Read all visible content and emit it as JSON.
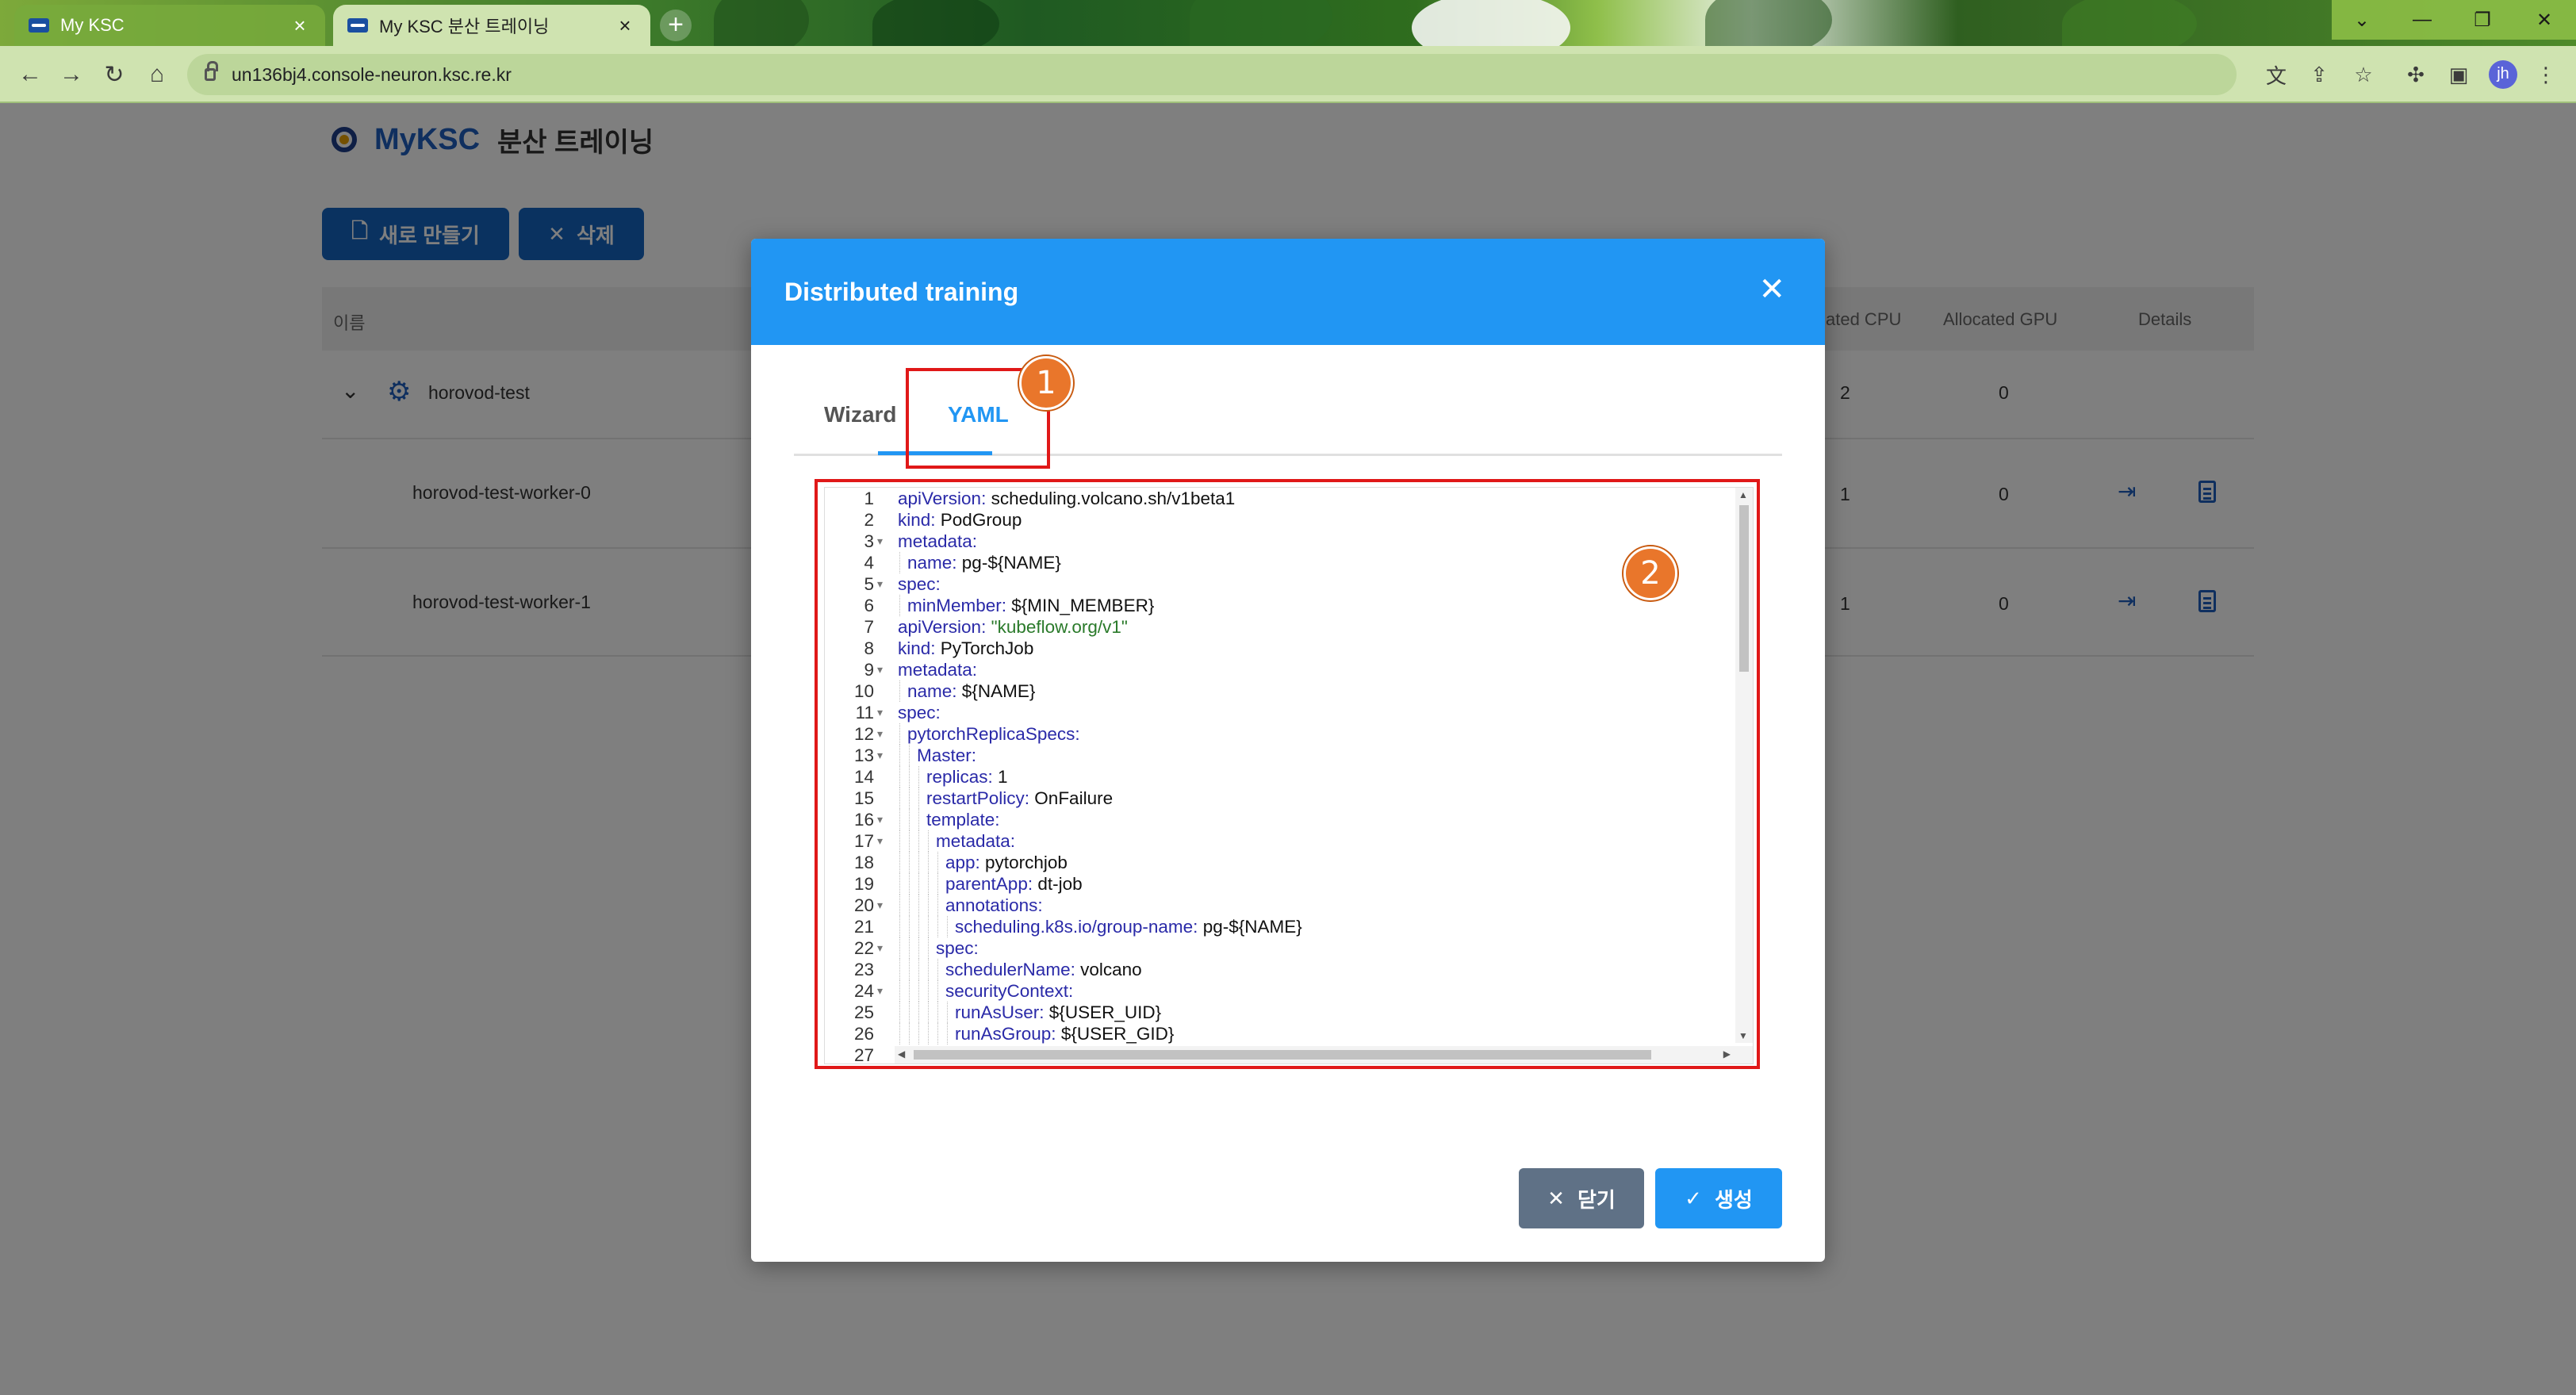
{
  "browser": {
    "tabs": [
      {
        "label": "My KSC",
        "active": false
      },
      {
        "label": "My KSC 분산 트레이닝",
        "active": true
      }
    ],
    "url": "un136bj4.console-neuron.ksc.re.kr",
    "profile_initials": "jh"
  },
  "page": {
    "brand": "MyKSC",
    "title": "분산 트레이닝",
    "new_button": "새로 만들기",
    "delete_button": "삭제",
    "table": {
      "columns": [
        "이름",
        "ated CPU",
        "Allocated GPU",
        "Details"
      ],
      "rows": [
        {
          "name": "horovod-test",
          "cpu": "2",
          "gpu": "0",
          "expanded": true
        },
        {
          "name": "horovod-test-worker-0",
          "cpu": "1",
          "gpu": "0"
        },
        {
          "name": "horovod-test-worker-1",
          "cpu": "1",
          "gpu": "0"
        }
      ]
    }
  },
  "modal": {
    "title": "Distributed training",
    "tabs": {
      "wizard": "Wizard",
      "yaml": "YAML"
    },
    "active_tab": "YAML",
    "badges": {
      "one": "1",
      "two": "2"
    },
    "close_button": "닫기",
    "create_button": "생성",
    "yaml_lines": [
      {
        "n": "1",
        "fold": false,
        "indent": 0,
        "key": "apiVersion",
        "val": " scheduling.volcano.sh/v1beta1",
        "str": false
      },
      {
        "n": "2",
        "fold": false,
        "indent": 0,
        "key": "kind",
        "val": " PodGroup",
        "str": false
      },
      {
        "n": "3",
        "fold": true,
        "indent": 0,
        "key": "metadata",
        "val": "",
        "str": false
      },
      {
        "n": "4",
        "fold": false,
        "indent": 1,
        "key": "name",
        "val": " pg-${NAME}",
        "str": false
      },
      {
        "n": "5",
        "fold": true,
        "indent": 0,
        "key": "spec",
        "val": "",
        "str": false
      },
      {
        "n": "6",
        "fold": false,
        "indent": 1,
        "key": "minMember",
        "val": " ${MIN_MEMBER}",
        "str": false
      },
      {
        "n": "7",
        "fold": false,
        "indent": 0,
        "key": "apiVersion",
        "val": " \"kubeflow.org/v1\"",
        "str": true
      },
      {
        "n": "8",
        "fold": false,
        "indent": 0,
        "key": "kind",
        "val": " PyTorchJob",
        "str": false
      },
      {
        "n": "9",
        "fold": true,
        "indent": 0,
        "key": "metadata",
        "val": "",
        "str": false
      },
      {
        "n": "10",
        "fold": false,
        "indent": 1,
        "key": "name",
        "val": " ${NAME}",
        "str": false
      },
      {
        "n": "11",
        "fold": true,
        "indent": 0,
        "key": "spec",
        "val": "",
        "str": false
      },
      {
        "n": "12",
        "fold": true,
        "indent": 1,
        "key": "pytorchReplicaSpecs",
        "val": "",
        "str": false
      },
      {
        "n": "13",
        "fold": true,
        "indent": 2,
        "key": "Master",
        "val": "",
        "str": false
      },
      {
        "n": "14",
        "fold": false,
        "indent": 3,
        "key": "replicas",
        "val": " 1",
        "str": false
      },
      {
        "n": "15",
        "fold": false,
        "indent": 3,
        "key": "restartPolicy",
        "val": " OnFailure",
        "str": false
      },
      {
        "n": "16",
        "fold": true,
        "indent": 3,
        "key": "template",
        "val": "",
        "str": false
      },
      {
        "n": "17",
        "fold": true,
        "indent": 4,
        "key": "metadata",
        "val": "",
        "str": false
      },
      {
        "n": "18",
        "fold": false,
        "indent": 5,
        "key": "app",
        "val": " pytorchjob",
        "str": false
      },
      {
        "n": "19",
        "fold": false,
        "indent": 5,
        "key": "parentApp",
        "val": " dt-job",
        "str": false
      },
      {
        "n": "20",
        "fold": true,
        "indent": 5,
        "key": "annotations",
        "val": "",
        "str": false
      },
      {
        "n": "21",
        "fold": false,
        "indent": 6,
        "key": "scheduling.k8s.io/group-name",
        "val": " pg-${NAME}",
        "str": false
      },
      {
        "n": "22",
        "fold": true,
        "indent": 4,
        "key": "spec",
        "val": "",
        "str": false
      },
      {
        "n": "23",
        "fold": false,
        "indent": 5,
        "key": "schedulerName",
        "val": " volcano",
        "str": false
      },
      {
        "n": "24",
        "fold": true,
        "indent": 5,
        "key": "securityContext",
        "val": "",
        "str": false
      },
      {
        "n": "25",
        "fold": false,
        "indent": 6,
        "key": "runAsUser",
        "val": " ${USER_UID}",
        "str": false
      },
      {
        "n": "26",
        "fold": false,
        "indent": 6,
        "key": "runAsGroup",
        "val": " ${USER_GID}",
        "str": false
      },
      {
        "n": "27",
        "fold": false,
        "indent": 0,
        "key": "",
        "val": "",
        "str": false
      }
    ]
  },
  "icons": {
    "back": "arrow-left-icon",
    "forward": "arrow-right-icon",
    "reload": "reload-icon",
    "home": "home-icon",
    "translate": "translate-icon",
    "share": "share-icon",
    "star": "star-icon",
    "extensions": "puzzle-icon",
    "sidepanel": "side-panel-icon",
    "menu": "kebab-menu-icon"
  },
  "colors": {
    "modal_header": "#2196f3",
    "primary_button": "#1565c0",
    "close_button": "#5f7186",
    "highlight": "#e01818",
    "badge": "#e9762b"
  }
}
